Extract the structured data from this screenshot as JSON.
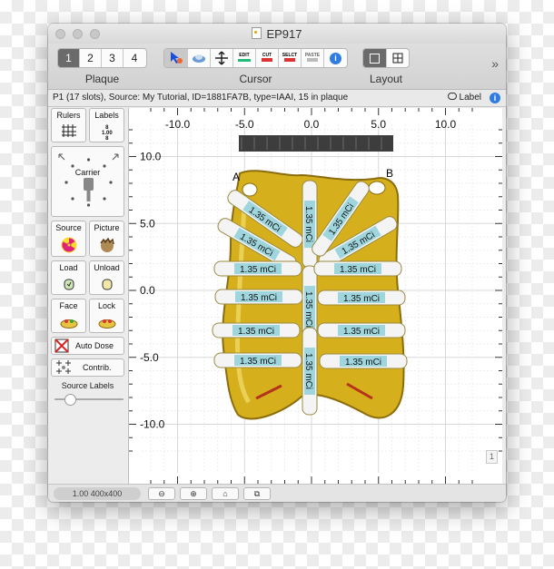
{
  "window": {
    "title": "EP917"
  },
  "toolbar": {
    "plaque": {
      "label": "Plaque",
      "buttons": [
        "1",
        "2",
        "3",
        "4"
      ],
      "selected": "1"
    },
    "cursor": {
      "label": "Cursor",
      "tools": [
        {
          "name": "select",
          "icon": "select-cursor-icon"
        },
        {
          "name": "eye",
          "icon": "eye-plaque-icon"
        },
        {
          "name": "move",
          "icon": "move-arrows-icon"
        },
        {
          "name": "edit",
          "icon": "edit-tool-icon",
          "text": "EDIT"
        },
        {
          "name": "cut",
          "icon": "cut-tool-icon",
          "text": "CUT"
        },
        {
          "name": "select_text",
          "icon": "select-tool-icon",
          "text": "SELCT"
        },
        {
          "name": "paste",
          "icon": "paste-tool-icon",
          "text": "PASTE"
        },
        {
          "name": "info",
          "icon": "info-icon"
        }
      ]
    },
    "layout": {
      "label": "Layout"
    }
  },
  "info": {
    "text": "P1 (17 slots), Source: My Tutorial, ID=1881FA7B, type=IAAI, 15 in plaque",
    "label_button": "Label"
  },
  "sidebar": {
    "rulers": "Rulers",
    "labels": "Labels",
    "carrier": "Carrier",
    "source": "Source",
    "picture": "Picture",
    "load": "Load",
    "unload": "Unload",
    "face": "Face",
    "lock": "Lock",
    "auto_dose": "Auto Dose",
    "contrib": "Contrib.",
    "source_labels": "Source Labels",
    "source_labels_level": 0.15
  },
  "ruler": {
    "x_ticks": [
      -10.0,
      -5.0,
      0.0,
      5.0,
      10.0
    ],
    "x_tick_labels": [
      "-10.0",
      "-5.0",
      "0.0",
      "5.0",
      "10.0"
    ],
    "y_ticks": [
      10.0,
      5.0,
      0.0,
      -5.0,
      -10.0
    ],
    "y_tick_labels": [
      "10.0",
      "5.0",
      "0.0",
      "-5.0",
      "-10.0"
    ]
  },
  "plaque": {
    "corner_labels": [
      "A",
      "B"
    ],
    "seed_activity": "1.35 mCi",
    "seeds": [
      {
        "id": "L1",
        "label": "1.35 mCi"
      },
      {
        "id": "L2",
        "label": "1.35 mCi"
      },
      {
        "id": "L3",
        "label": "1.35 mCi"
      },
      {
        "id": "L4",
        "label": "1.35 mCi"
      },
      {
        "id": "L5",
        "label": "1.35 mCi"
      },
      {
        "id": "L6",
        "label": "1.35 mCi"
      },
      {
        "id": "C1",
        "label": "1.35 mCi"
      },
      {
        "id": "C2",
        "label": "1.35 mCi"
      },
      {
        "id": "C3",
        "label": "1.35 mCi"
      },
      {
        "id": "R1",
        "label": "1.35 mCi"
      },
      {
        "id": "R2",
        "label": "1.35 mCi"
      },
      {
        "id": "R3",
        "label": "1.35 mCi"
      },
      {
        "id": "R4",
        "label": "1.35 mCi"
      },
      {
        "id": "R5",
        "label": "1.35 mCi"
      },
      {
        "id": "R6",
        "label": "1.35 mCi"
      }
    ]
  },
  "status": {
    "zoom": "1.00 400x400",
    "page_indicator": "1"
  },
  "colors": {
    "accent": "#2f7de1",
    "plaque_gold": "#d8b21e",
    "seed_fill": "#9fd6de"
  }
}
